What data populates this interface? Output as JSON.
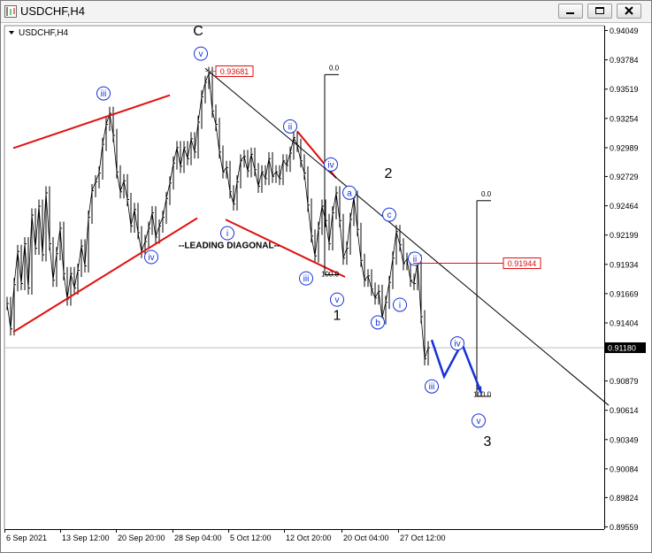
{
  "window": {
    "title": "USDCHF,H4",
    "controls": {
      "minimize": "minimize",
      "maximize": "maximize",
      "close": "close"
    }
  },
  "colors": {
    "candles": "#000000",
    "channel_lines": "#e01010",
    "projection": "#1530d8",
    "wave_labels": "#1530d8",
    "price_label_border": "#e01010",
    "price_label_text": "#d01010",
    "background": "#ffffff"
  },
  "chart_data": {
    "type": "line",
    "symbol_label": "USDCHF,H4",
    "x_ticks": [
      "6 Sep 2021",
      "13 Sep 12:00",
      "20 Sep 20:00",
      "28 Sep 04:00",
      "5 Oct 12:00",
      "12 Oct 20:00",
      "20 Oct 04:00",
      "27 Oct 12:00"
    ],
    "y_ticks": [
      0.94049,
      0.93784,
      0.93519,
      0.93254,
      0.92989,
      0.92729,
      0.92464,
      0.92199,
      0.91934,
      0.91669,
      0.91404,
      0.9118,
      0.90879,
      0.90614,
      0.90349,
      0.90084,
      0.89824,
      0.89559
    ],
    "ylim": [
      0.89559,
      0.94049
    ],
    "grid": false,
    "current_price": "0.91180",
    "price_labels": [
      "0.93681",
      "0.91944"
    ],
    "fib_labels": [
      "0.0",
      "100.0",
      "0.0",
      "100.0"
    ],
    "annotation": "--LEADING DIAGONAL--",
    "wave_labels": [
      "C",
      "v",
      "iii",
      "iv",
      "ii",
      "iv",
      "a",
      "i",
      "iii",
      "v",
      "1",
      "2",
      "c",
      "b",
      "i",
      "ii",
      "iv",
      "iii",
      "v",
      "3"
    ],
    "price_series": [
      {
        "t": 0,
        "v": 0.9158
      },
      {
        "t": 4,
        "v": 0.9135
      },
      {
        "t": 8,
        "v": 0.9175
      },
      {
        "t": 12,
        "v": 0.9205
      },
      {
        "t": 16,
        "v": 0.9176
      },
      {
        "t": 20,
        "v": 0.9212
      },
      {
        "t": 24,
        "v": 0.9172
      },
      {
        "t": 28,
        "v": 0.9238
      },
      {
        "t": 32,
        "v": 0.9208
      },
      {
        "t": 36,
        "v": 0.9246
      },
      {
        "t": 40,
        "v": 0.9202
      },
      {
        "t": 44,
        "v": 0.9258
      },
      {
        "t": 48,
        "v": 0.9212
      },
      {
        "t": 52,
        "v": 0.9179
      },
      {
        "t": 56,
        "v": 0.9203
      },
      {
        "t": 60,
        "v": 0.9226
      },
      {
        "t": 64,
        "v": 0.9185
      },
      {
        "t": 68,
        "v": 0.9162
      },
      {
        "t": 72,
        "v": 0.9185
      },
      {
        "t": 76,
        "v": 0.9172
      },
      {
        "t": 80,
        "v": 0.9188
      },
      {
        "t": 84,
        "v": 0.921
      },
      {
        "t": 88,
        "v": 0.9192
      },
      {
        "t": 92,
        "v": 0.9236
      },
      {
        "t": 96,
        "v": 0.926
      },
      {
        "t": 100,
        "v": 0.9268
      },
      {
        "t": 104,
        "v": 0.9276
      },
      {
        "t": 108,
        "v": 0.9302
      },
      {
        "t": 112,
        "v": 0.932
      },
      {
        "t": 116,
        "v": 0.933
      },
      {
        "t": 120,
        "v": 0.931
      },
      {
        "t": 124,
        "v": 0.9277
      },
      {
        "t": 128,
        "v": 0.9259
      },
      {
        "t": 132,
        "v": 0.9269
      },
      {
        "t": 136,
        "v": 0.9252
      },
      {
        "t": 140,
        "v": 0.9228
      },
      {
        "t": 144,
        "v": 0.9243
      },
      {
        "t": 148,
        "v": 0.9222
      },
      {
        "t": 152,
        "v": 0.9205
      },
      {
        "t": 156,
        "v": 0.9214
      },
      {
        "t": 160,
        "v": 0.9226
      },
      {
        "t": 164,
        "v": 0.924
      },
      {
        "t": 168,
        "v": 0.9218
      },
      {
        "t": 172,
        "v": 0.9228
      },
      {
        "t": 176,
        "v": 0.9236
      },
      {
        "t": 180,
        "v": 0.9253
      },
      {
        "t": 184,
        "v": 0.9267
      },
      {
        "t": 188,
        "v": 0.9285
      },
      {
        "t": 192,
        "v": 0.9299
      },
      {
        "t": 196,
        "v": 0.9282
      },
      {
        "t": 200,
        "v": 0.9299
      },
      {
        "t": 204,
        "v": 0.9289
      },
      {
        "t": 208,
        "v": 0.9307
      },
      {
        "t": 212,
        "v": 0.9295
      },
      {
        "t": 216,
        "v": 0.9322
      },
      {
        "t": 220,
        "v": 0.9345
      },
      {
        "t": 224,
        "v": 0.9358
      },
      {
        "t": 228,
        "v": 0.9366
      },
      {
        "t": 232,
        "v": 0.9332
      },
      {
        "t": 236,
        "v": 0.932
      },
      {
        "t": 240,
        "v": 0.9295
      },
      {
        "t": 244,
        "v": 0.9277
      },
      {
        "t": 248,
        "v": 0.9281
      },
      {
        "t": 252,
        "v": 0.9259
      },
      {
        "t": 256,
        "v": 0.9248
      },
      {
        "t": 260,
        "v": 0.9268
      },
      {
        "t": 264,
        "v": 0.9287
      },
      {
        "t": 268,
        "v": 0.9291
      },
      {
        "t": 272,
        "v": 0.9278
      },
      {
        "t": 276,
        "v": 0.9293
      },
      {
        "t": 280,
        "v": 0.9279
      },
      {
        "t": 284,
        "v": 0.9264
      },
      {
        "t": 288,
        "v": 0.9277
      },
      {
        "t": 292,
        "v": 0.9271
      },
      {
        "t": 296,
        "v": 0.9289
      },
      {
        "t": 300,
        "v": 0.9273
      },
      {
        "t": 304,
        "v": 0.9277
      },
      {
        "t": 308,
        "v": 0.9271
      },
      {
        "t": 312,
        "v": 0.9287
      },
      {
        "t": 316,
        "v": 0.9283
      },
      {
        "t": 320,
        "v": 0.9294
      },
      {
        "t": 324,
        "v": 0.9308
      },
      {
        "t": 328,
        "v": 0.9301
      },
      {
        "t": 332,
        "v": 0.9287
      },
      {
        "t": 336,
        "v": 0.9276
      },
      {
        "t": 340,
        "v": 0.9247
      },
      {
        "t": 344,
        "v": 0.9219
      },
      {
        "t": 348,
        "v": 0.9201
      },
      {
        "t": 352,
        "v": 0.9226
      },
      {
        "t": 356,
        "v": 0.9246
      },
      {
        "t": 360,
        "v": 0.9233
      },
      {
        "t": 364,
        "v": 0.9212
      },
      {
        "t": 368,
        "v": 0.924
      },
      {
        "t": 372,
        "v": 0.9258
      },
      {
        "t": 376,
        "v": 0.9233
      },
      {
        "t": 380,
        "v": 0.9199
      },
      {
        "t": 384,
        "v": 0.9208
      },
      {
        "t": 388,
        "v": 0.9234
      },
      {
        "t": 392,
        "v": 0.9254
      },
      {
        "t": 396,
        "v": 0.9225
      },
      {
        "t": 400,
        "v": 0.9197
      },
      {
        "t": 404,
        "v": 0.9179
      },
      {
        "t": 408,
        "v": 0.9183
      },
      {
        "t": 412,
        "v": 0.9171
      },
      {
        "t": 416,
        "v": 0.9163
      },
      {
        "t": 420,
        "v": 0.9169
      },
      {
        "t": 424,
        "v": 0.9145
      },
      {
        "t": 428,
        "v": 0.9159
      },
      {
        "t": 432,
        "v": 0.9177
      },
      {
        "t": 436,
        "v": 0.9199
      },
      {
        "t": 440,
        "v": 0.9223
      },
      {
        "t": 444,
        "v": 0.9211
      },
      {
        "t": 448,
        "v": 0.9194
      },
      {
        "t": 452,
        "v": 0.9198
      },
      {
        "t": 456,
        "v": 0.9179
      },
      {
        "t": 460,
        "v": 0.9176
      },
      {
        "t": 464,
        "v": 0.9196
      },
      {
        "t": 468,
        "v": 0.9146
      },
      {
        "t": 472,
        "v": 0.9108
      },
      {
        "t": 476,
        "v": 0.9118
      }
    ],
    "projection_path": [
      {
        "t": 480,
        "v": 0.9125
      },
      {
        "t": 494,
        "v": 0.9092
      },
      {
        "t": 514,
        "v": 0.9122
      },
      {
        "t": 536,
        "v": 0.9077
      }
    ],
    "lines": [
      {
        "kind": "channel",
        "from": {
          "t": 7,
          "v": 0.92985
        },
        "to": {
          "t": 184,
          "v": 0.93464
        }
      },
      {
        "kind": "channel",
        "from": {
          "t": 7,
          "v": 0.91322
        },
        "to": {
          "t": 215,
          "v": 0.92352
        }
      },
      {
        "kind": "channel",
        "from": {
          "t": 247,
          "v": 0.92339
        },
        "to": {
          "t": 382,
          "v": 0.9182
        }
      },
      {
        "kind": "channel",
        "from": {
          "t": 328,
          "v": 0.93137
        },
        "to": {
          "t": 372,
          "v": 0.92715
        }
      },
      {
        "kind": "trendline",
        "from": {
          "t": 224,
          "v": 0.93707
        },
        "to": {
          "t": 680,
          "v": 0.90659
        }
      }
    ]
  }
}
